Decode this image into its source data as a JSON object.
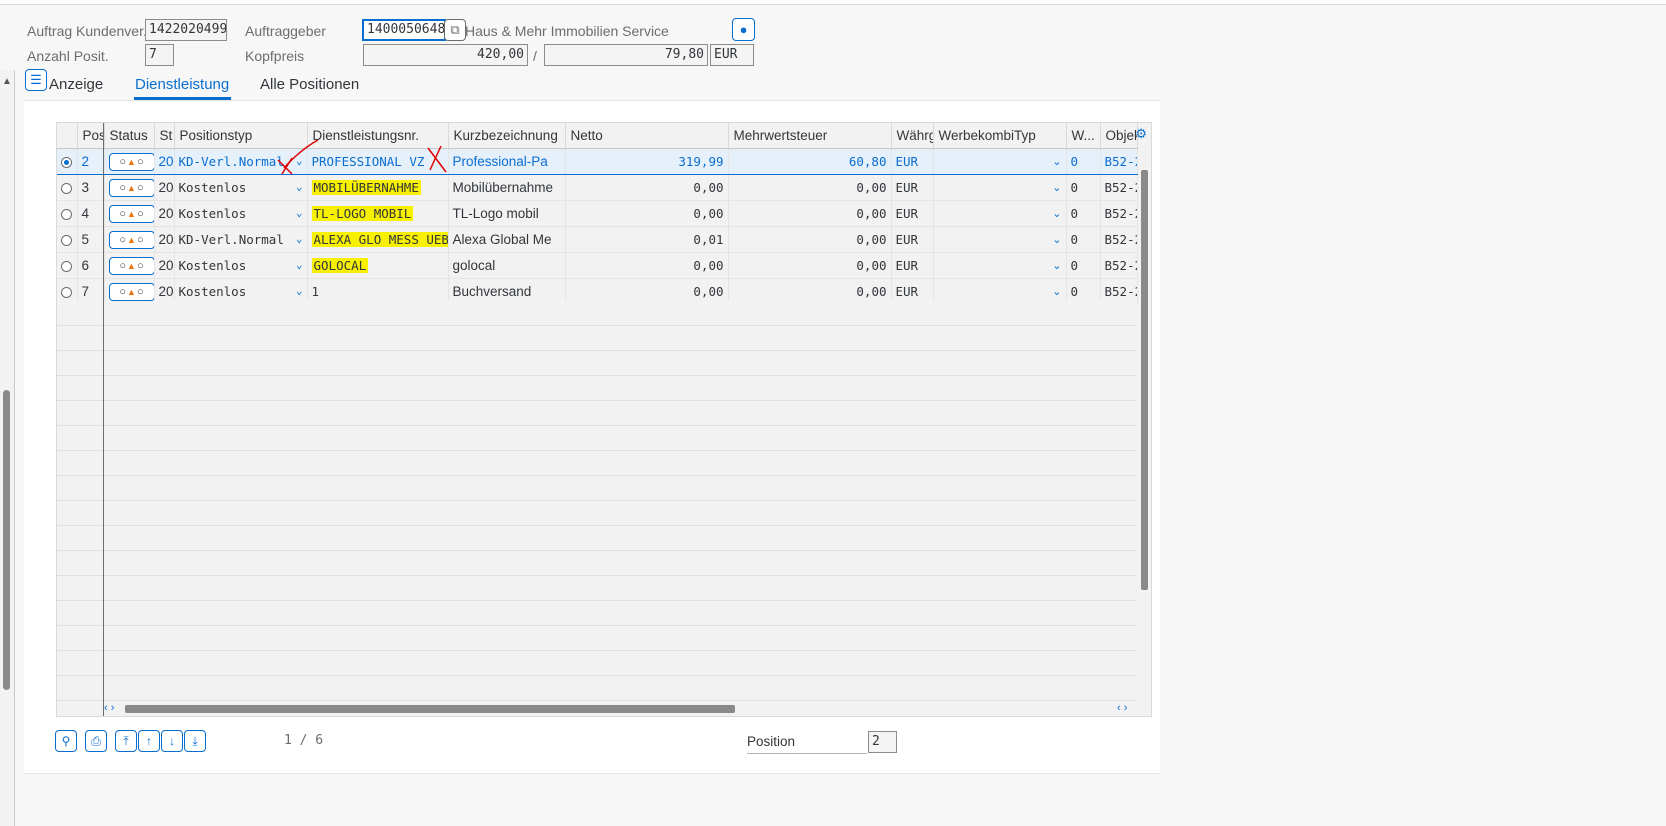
{
  "header": {
    "auftrag_label": "Auftrag Kundenver...",
    "auftrag_value": "1422020499",
    "anzahl_label": "Anzahl Posit.",
    "anzahl_value": "7",
    "auftraggeber_label": "Auftraggeber",
    "auftraggeber_value": "1400050648",
    "auftraggeber_name": "Haus & Mehr Immobilien Service",
    "kopfpreis_label": "Kopfpreis",
    "kopfpreis_value": "420,00",
    "slash": "/",
    "kopfpreis_tax": "79,80",
    "currency": "EUR"
  },
  "tabs": [
    {
      "label": "Anzeige"
    },
    {
      "label": "Dienstleistung"
    },
    {
      "label": "Alle Positionen"
    }
  ],
  "table": {
    "columns": [
      "Pos",
      "Status",
      "St",
      "Positionstyp",
      "Dienstleistungsnr.",
      "Kurzbezeichnung",
      "Netto",
      "Mehrwertsteuer",
      "Währg",
      "WerbekombiTyp",
      "W...",
      "Objek"
    ],
    "rows": [
      {
        "pos": "2",
        "st": "20",
        "typ": "KD-Verl.Normal",
        "nr": "PROFESSIONAL VZ",
        "kurz": "Professional-Pa",
        "netto": "319,99",
        "mwst": "60,80",
        "waehrg": "EUR",
        "w": "0",
        "objek": "B52-2"
      },
      {
        "pos": "3",
        "st": "20",
        "typ": "Kostenlos",
        "nr": "MOBILÜBERNAHME",
        "kurz": "Mobilübernahme",
        "netto": "0,00",
        "mwst": "0,00",
        "waehrg": "EUR",
        "w": "0",
        "objek": "B52-2"
      },
      {
        "pos": "4",
        "st": "20",
        "typ": "Kostenlos",
        "nr": "TL-LOGO MOBIL",
        "kurz": "TL-Logo mobil",
        "netto": "0,00",
        "mwst": "0,00",
        "waehrg": "EUR",
        "w": "0",
        "objek": "B52-2"
      },
      {
        "pos": "5",
        "st": "20",
        "typ": "KD-Verl.Normal",
        "nr": "ALEXA GLO MESS UEB",
        "kurz": "Alexa Global Me",
        "netto": "0,01",
        "mwst": "0,00",
        "waehrg": "EUR",
        "w": "0",
        "objek": "B52-2"
      },
      {
        "pos": "6",
        "st": "20",
        "typ": "Kostenlos",
        "nr": "GOLOCAL",
        "kurz": "golocal",
        "netto": "0,00",
        "mwst": "0,00",
        "waehrg": "EUR",
        "w": "0",
        "objek": "B52-2"
      },
      {
        "pos": "7",
        "st": "20",
        "typ": "Kostenlos",
        "nr": "1",
        "kurz": "Buchversand",
        "netto": "0,00",
        "mwst": "0,00",
        "waehrg": "EUR",
        "w": "0",
        "objek": "B52-2"
      }
    ]
  },
  "footer": {
    "pager": "1 / 6",
    "position_label": "Position",
    "position_value": "2"
  },
  "colors": {
    "accent": "#0a6ed1",
    "highlight": "#f7f000",
    "annotation": "#e00000"
  },
  "icons": [
    "value-help-icon",
    "hat-icon",
    "toggle-panel-icon",
    "zoom-icon",
    "print-icon",
    "first-page-icon",
    "previous-page-icon",
    "next-page-icon",
    "last-page-icon",
    "settings-icon"
  ]
}
